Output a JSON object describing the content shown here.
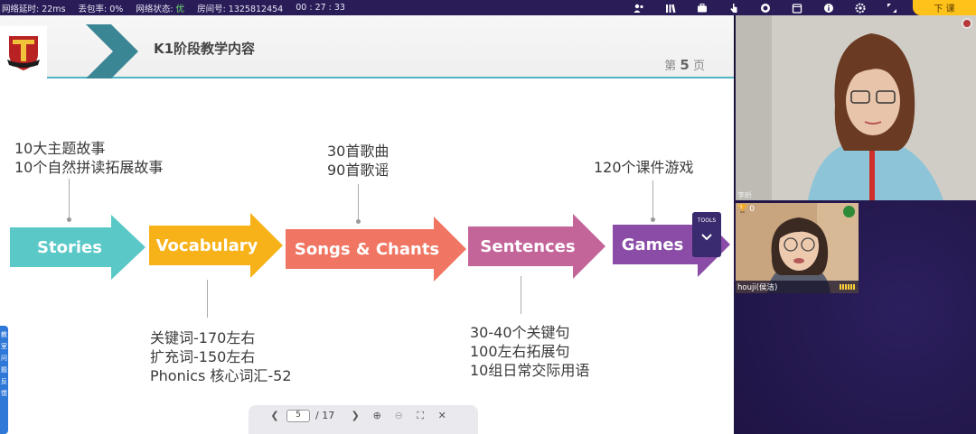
{
  "topbar": {
    "latency": "网络延时: 22ms",
    "packet_loss": "丢包率: 0%",
    "network_label": "网络状态: ",
    "network_value": "优",
    "room": "房间号: 1325812454",
    "timer": "00 : 27 : 33",
    "end_class": "下 课"
  },
  "slide": {
    "title": "K1阶段教学内容",
    "page_prefix": "第",
    "page_number": "5",
    "page_suffix": "页",
    "notes": {
      "stories_1": "10大主题故事",
      "stories_2": "10个自然拼读拓展故事",
      "songs_1": "30首歌曲",
      "songs_2": "90首歌谣",
      "games_1": "120个课件游戏",
      "vocab_1": "关键词-170左右",
      "vocab_2": "扩充词-150左右",
      "vocab_3": "Phonics 核心词汇-52",
      "sent_1": "30-40个关键句",
      "sent_2": "100左右拓展句",
      "sent_3": "10组日常交际用语"
    },
    "arrows": {
      "stories": "Stories",
      "vocabulary": "Vocabulary",
      "songs": "Songs & Chants",
      "sentences": "Sentences",
      "games": "Games"
    },
    "colors": {
      "stories": "#5bc8c8",
      "vocabulary": "#f7b21a",
      "songs": "#f07563",
      "sentences": "#c4659a",
      "games": "#8a4ca6"
    },
    "tools_label": "TOOLS"
  },
  "pager": {
    "current": "5",
    "total": "/ 17"
  },
  "side_tab": "教室问题反馈",
  "video": {
    "teacher_name": "李昕",
    "student_name": "houji(侯洁)",
    "student_score": "0"
  }
}
